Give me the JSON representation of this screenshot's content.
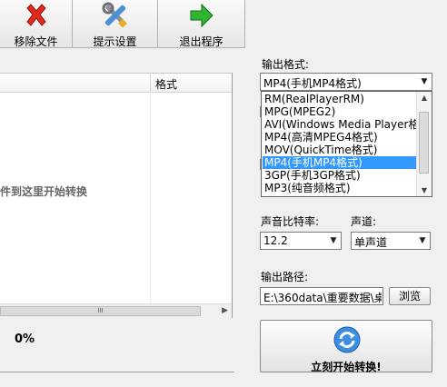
{
  "toolbar": {
    "remove_label": "移除文件",
    "settings_label": "提示设置",
    "exit_label": "退出程序"
  },
  "file_list": {
    "col_format": "格式",
    "drop_hint": "件到这里开始转换",
    "scroll_thumb": "III"
  },
  "progress": {
    "text": "0%"
  },
  "output_format": {
    "label": "输出格式:",
    "selected": "MP4(手机MP4格式)",
    "options": [
      "RM(RealPlayerRM)",
      "MPG(MPEG2)",
      "AVI(Windows Media Player格式)",
      "MP4(高清MPEG4格式)",
      "MOV(QuickTime格式)",
      "MP4(手机MP4格式)",
      "3GP(手机3GP格式)",
      "MP3(纯音频格式)"
    ],
    "highlighted_index": 5
  },
  "audio": {
    "bitrate_label": "声音比特率:",
    "bitrate_value": "12.2",
    "channel_label": "声道:",
    "channel_value": "单声道"
  },
  "output_path": {
    "label": "输出路径:",
    "value": "E:\\360data\\重要数据\\桌",
    "browse_label": "浏览"
  },
  "start_button": {
    "label": "立刻开始转换!"
  },
  "colors": {
    "selection": "#3399ff",
    "background": "#f0f0f0"
  }
}
